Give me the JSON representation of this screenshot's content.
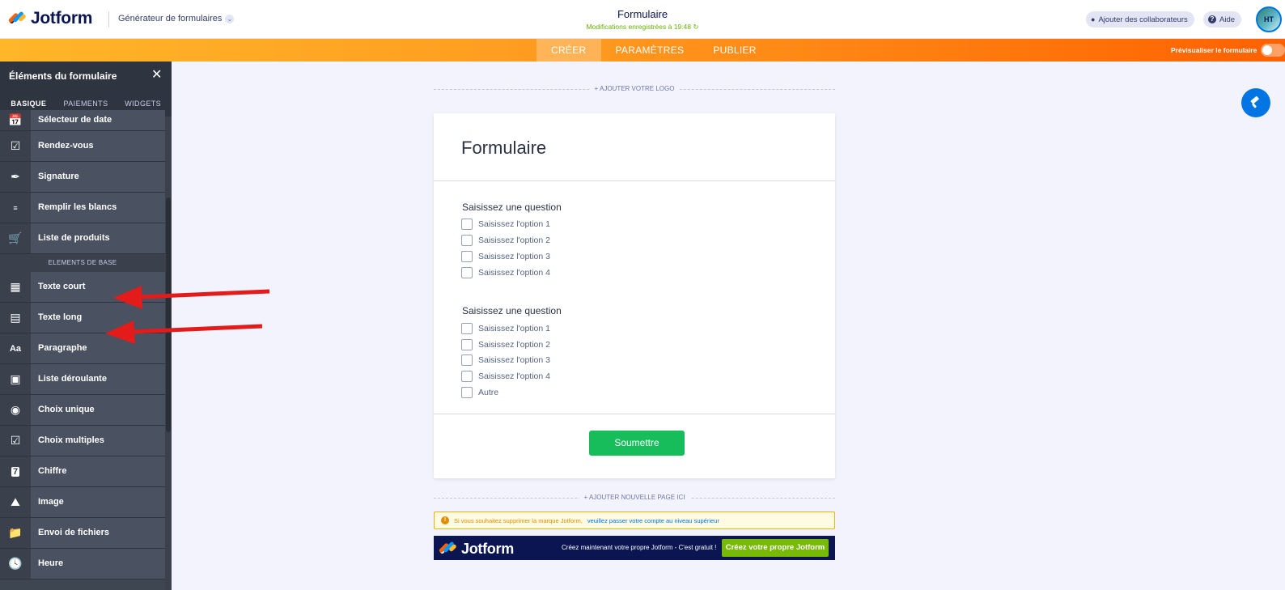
{
  "header": {
    "logo_text": "Jotform",
    "builder_menu": "Générateur de formulaires",
    "form_title": "Formulaire",
    "save_status": "Modifications enregistrées à 19:48",
    "collab_label": "Ajouter des collaborateurs",
    "help_label": "Aide",
    "avatar_initials": "HT"
  },
  "nav": {
    "tabs": [
      {
        "label": "CRÉER",
        "active": true
      },
      {
        "label": "PARAMÈTRES",
        "active": false
      },
      {
        "label": "PUBLIER",
        "active": false
      }
    ],
    "preview_label": "Prévisualiser le formulaire"
  },
  "sidebar": {
    "title": "Éléments du formulaire",
    "close_icon": "close-icon",
    "tabs": [
      {
        "label": "BASIQUE",
        "active": true
      },
      {
        "label": "PAIEMENTS",
        "active": false
      },
      {
        "label": "WIDGETS",
        "active": false
      }
    ],
    "items_top": [
      {
        "label": "Sélecteur de date",
        "icon": "calendar-icon"
      },
      {
        "label": "Rendez-vous",
        "icon": "appointment-icon"
      },
      {
        "label": "Signature",
        "icon": "signature-icon"
      },
      {
        "label": "Remplir les blancs",
        "icon": "fill-blank-icon"
      },
      {
        "label": "Liste de produits",
        "icon": "cart-icon"
      }
    ],
    "section_label": "ELEMENTS DE BASE",
    "items_basic": [
      {
        "label": "Texte court",
        "icon": "short-text-icon"
      },
      {
        "label": "Texte long",
        "icon": "long-text-icon"
      },
      {
        "label": "Paragraphe",
        "icon": "paragraph-icon"
      },
      {
        "label": "Liste déroulante",
        "icon": "dropdown-icon"
      },
      {
        "label": "Choix unique",
        "icon": "radio-icon"
      },
      {
        "label": "Choix multiples",
        "icon": "checkbox-icon"
      },
      {
        "label": "Chiffre",
        "icon": "number-icon"
      },
      {
        "label": "Image",
        "icon": "image-icon"
      },
      {
        "label": "Envoi de fichiers",
        "icon": "file-upload-icon"
      },
      {
        "label": "Heure",
        "icon": "clock-icon"
      }
    ]
  },
  "form": {
    "add_logo": "+ AJOUTER VOTRE LOGO",
    "title": "Formulaire",
    "questions": [
      {
        "label": "Saisissez une question",
        "options": [
          "Saisissez l'option 1",
          "Saisissez l'option 2",
          "Saisissez l'option 3",
          "Saisissez l'option 4"
        ]
      },
      {
        "label": "Saisissez une question",
        "options": [
          "Saisissez l'option 1",
          "Saisissez l'option 2",
          "Saisissez l'option 3",
          "Saisissez l'option 4",
          "Autre"
        ]
      }
    ],
    "submit_label": "Soumettre",
    "add_page": "+ AJOUTER NOUVELLE PAGE ICI"
  },
  "branding": {
    "notice_text": "Si vous souhaitez supprimer la marque Jotform,",
    "notice_link": "veuillez passer votre compte au niveau supérieur",
    "banner_logo": "Jotform",
    "banner_text": "Créez maintenant votre propre Jotform - C'est gratuit !",
    "banner_button": "Créez votre propre Jotform"
  },
  "colors": {
    "orange": "#ff6100",
    "sidebar": "#3e4652",
    "submit_green": "#18bd5b",
    "annotation_red": "#e31b1b"
  }
}
